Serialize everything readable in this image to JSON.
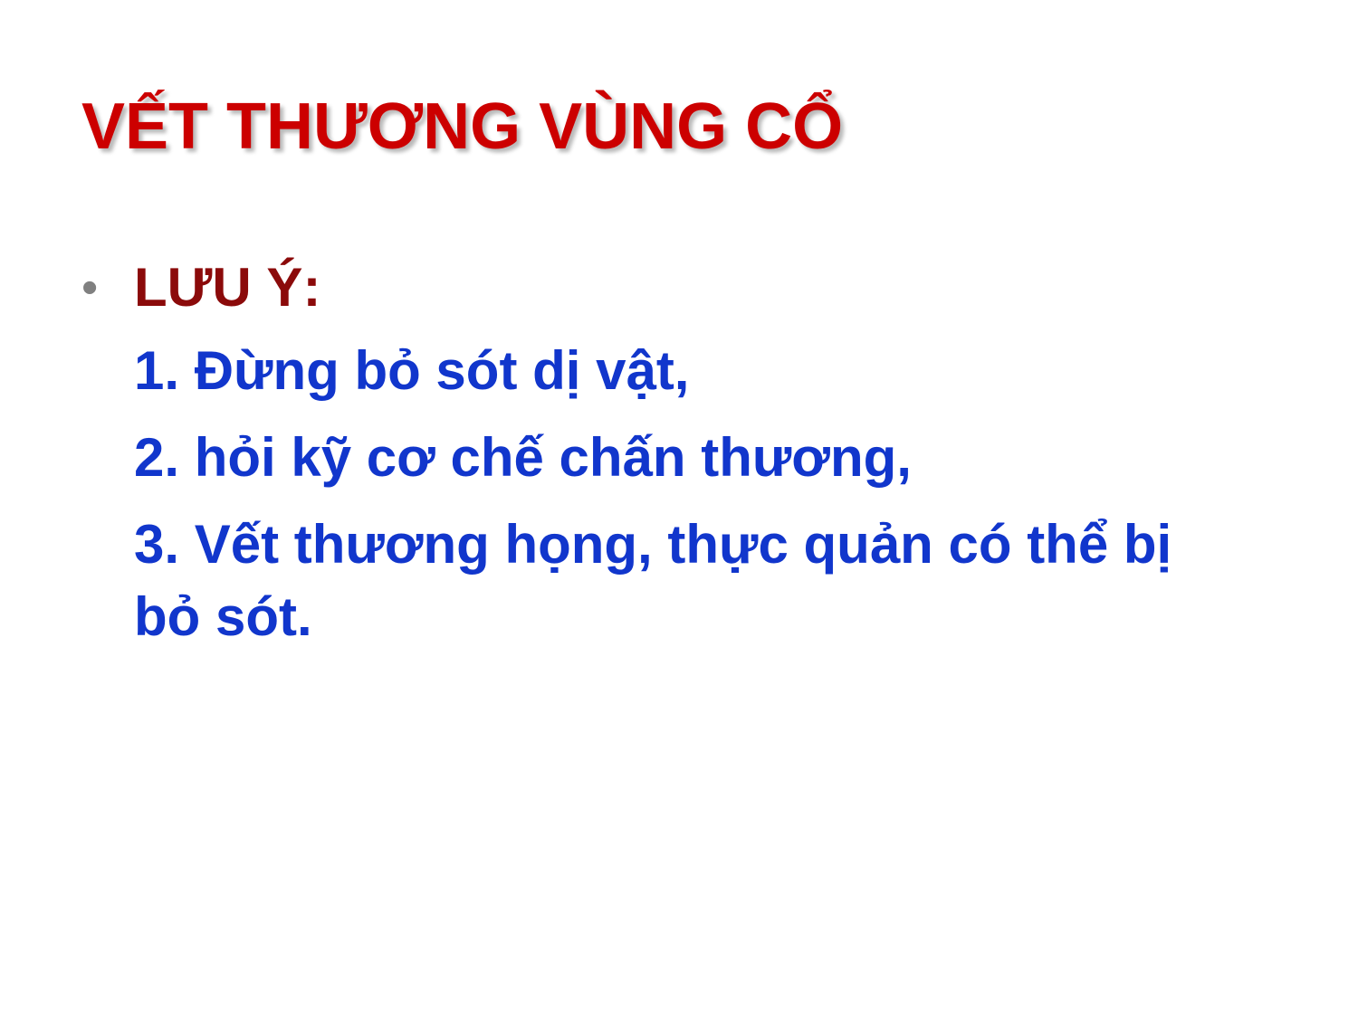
{
  "slide": {
    "title": "VẾT THƯƠNG VÙNG CỔ",
    "bullet": {
      "symbol": "•",
      "label": "LƯU Ý:"
    },
    "items": [
      "1. Đừng bỏ sót dị vật,",
      "2. hỏi kỹ cơ chế chấn thương,",
      "3. Vết thương họng, thực quản có thể bị bỏ sót."
    ]
  },
  "colors": {
    "title": "#cc0000",
    "label": "#8b0a0a",
    "items": "#1136cc",
    "bullet": "#808080"
  }
}
